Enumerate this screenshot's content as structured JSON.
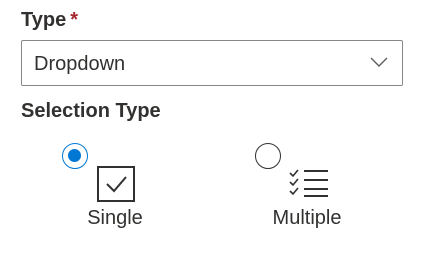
{
  "form": {
    "type_label": "Type",
    "required_marker": "*",
    "dropdown": {
      "selected_value": "Dropdown",
      "icon": "chevron-down-icon"
    },
    "selection_type_label": "Selection Type",
    "selection_options": [
      {
        "label": "Single",
        "icon": "single-check-icon",
        "selected": true
      },
      {
        "label": "Multiple",
        "icon": "checklist-icon",
        "selected": false
      }
    ]
  },
  "colors": {
    "accent": "#0078d4",
    "required": "#a4262c",
    "text": "#323130",
    "border": "#8a8886"
  }
}
